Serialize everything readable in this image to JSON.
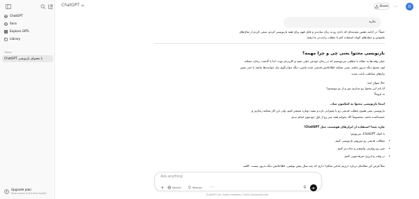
{
  "sidebar": {
    "items": [
      {
        "label": "ChatGPT",
        "icon": "chatgpt-logo-icon"
      },
      {
        "label": "Sora",
        "icon": "sora-icon"
      },
      {
        "label": "Explore GPTs",
        "icon": "grid-icon"
      },
      {
        "label": "Library",
        "icon": "library-icon"
      }
    ],
    "section_label": "Today",
    "chat_title": "ChatGPT با محتوای بازنویسی",
    "upgrade_title": "Upgrade plan",
    "upgrade_subtitle": "More access to the best models"
  },
  "header": {
    "model_label": "ChatGPT",
    "share_label": "Share",
    "avatar_letter": "D"
  },
  "conversation": {
    "user_message": "بنازید",
    "p1_l1": "حتماً! در ادامه، همین مقدمه‌ای که دادی رو به زبان ساده‌تر و قابل فهم برای همه بازنویسی کردم، سعی کردم از مثال‌های",
    "p1_l2": "ملموس و جمله‌های کوتاه استفاده کنم تا مطلب راحت‌تر جا بیفته:",
    "heading": "بازنویسی محتوا یعنی چی و چرا مهمه؟",
    "p2_l1": "خیلی وقت‌ها یه مقاله یا مطلبی می‌نویسیم که در زمان خودش خیلی مفید و کاربردی بوده. اما با گذشت زمان، ممکنه",
    "p2_l2": "اون محتوا دیگه به‌روز نباشه. یعنی ممکنه اطلاعاتش قدیمی شده باشن، دیگه جواب‌گوی نیاز خواننده‌ها نباشه یا حتی تغییر",
    "p2_l3": "نیازهای مخاطب باعث شده.",
    "q_intro": "حالا سوال اینه:",
    "q1": "آیا باید این محتوا رو بندازیم دور و از نو بنویسیم؟",
    "q2": "نه لزوماً!",
    "sub_heading": "اینجا بازنویسی محتوا به کمکمون میاد.",
    "p3_l1": "بازنویسی یعنی همون مطلب قدیمی رو با تغییراتی تازه و مفید دوباره منتشر کنیم، ولی این کار ممکنه زمان‌بر و",
    "p3_l2": "خسته‌کننده باشه، مخصوصاً اگه بخوایم همه چیز رو از اول خودمون انجام بدیم.",
    "sub_heading2": "چاره چیه؟ استفاده از ابزارهای هوشمند، مثل ChatGPT!",
    "bullets_intro": "با کمک ChatGPT، می‌تونیم:",
    "bullets": [
      "مطالب قدیمی رو سریع‌تر بازنویسی کنیم.",
      "متن رو روان‌تر، واضح‌تر و جذاب‌تر کنیم.",
      "در وقت و انرژی صرفه‌جویی کنیم."
    ],
    "cutoff_line": "مثلاً فرض کن مقاله‌ای درباره «رژیم غذایی سالم» داری که چند سال پیش نوشتی، اطلاعاتش دیگه به‌روز نیست. کافیه"
  },
  "composer": {
    "placeholder": "Ask anything",
    "search_label": "Search",
    "reason_label": "Reason"
  },
  "footer": {
    "disclaimer": "ChatGPT can make mistakes. Check important info."
  },
  "colors": {
    "sidebar_bg": "#f9f9f9",
    "active_chat_bg": "#e8e8e8",
    "avatar_bg": "#3f7ae0",
    "send_bg": "#0d0d0d"
  }
}
